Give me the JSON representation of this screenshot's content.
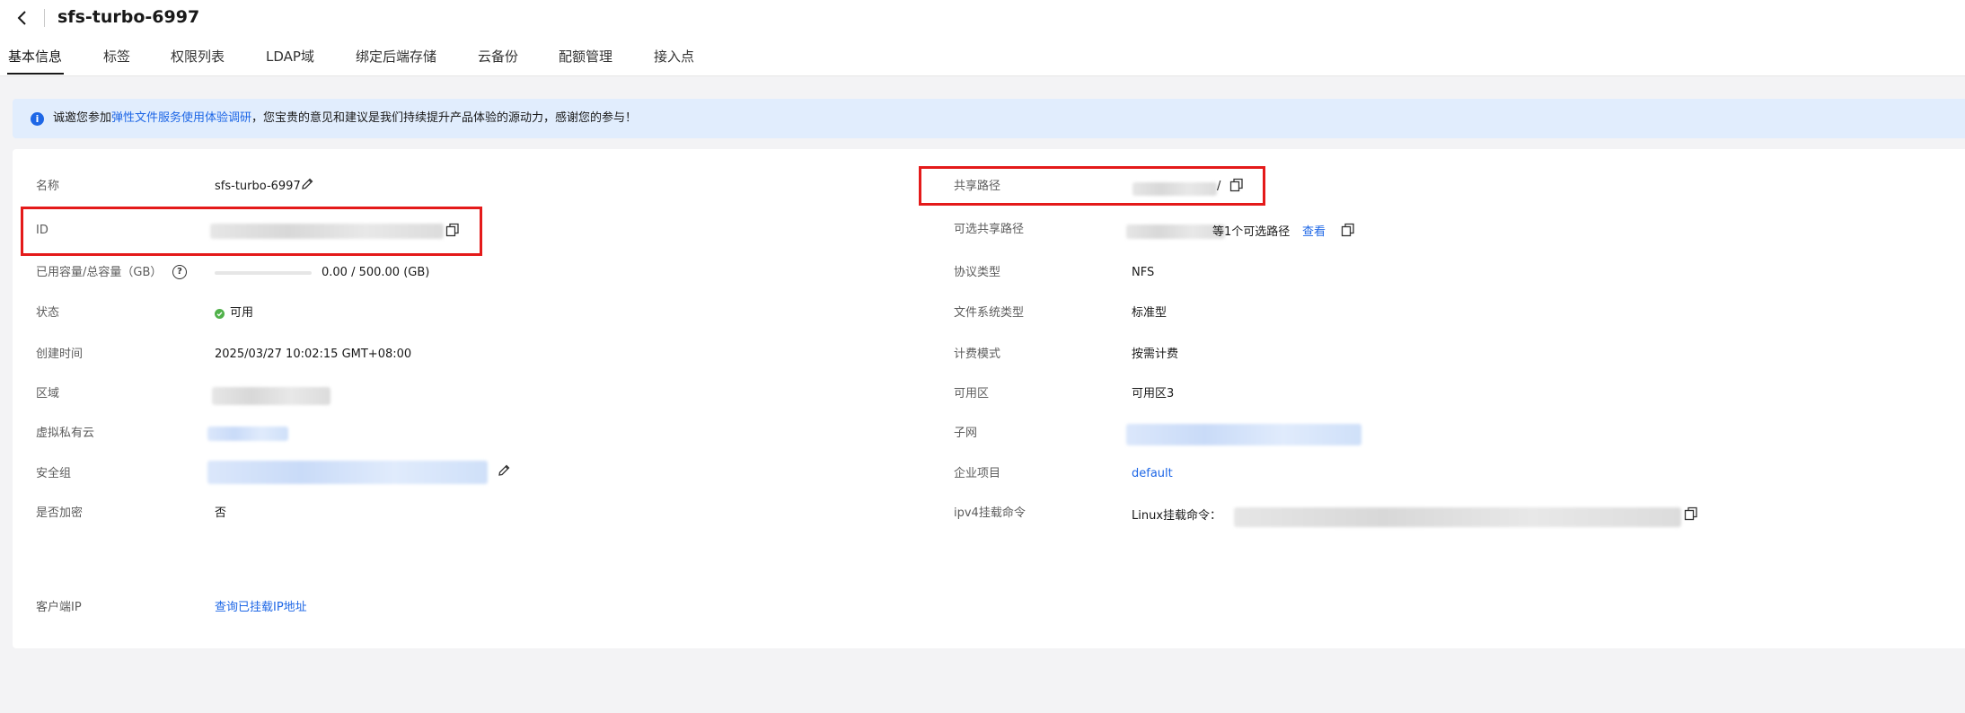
{
  "header": {
    "title": "sfs-turbo-6997"
  },
  "tabs": [
    {
      "label": "基本信息",
      "active": true
    },
    {
      "label": "标签"
    },
    {
      "label": "权限列表"
    },
    {
      "label": "LDAP域"
    },
    {
      "label": "绑定后端存储"
    },
    {
      "label": "云备份"
    },
    {
      "label": "配额管理"
    },
    {
      "label": "接入点"
    }
  ],
  "banner": {
    "prefix": "诚邀您参加",
    "link": "弹性文件服务使用体验调研",
    "suffix": "，您宝贵的意见和建议是我们持续提升产品体验的源动力，感谢您的参与！"
  },
  "left": {
    "name": {
      "label": "名称",
      "value": "sfs-turbo-6997"
    },
    "id": {
      "label": "ID"
    },
    "capacity": {
      "label": "已用容量/总容量（GB）",
      "value": "0.00 / 500.00 (GB)",
      "used_fraction": 0.0
    },
    "status": {
      "label": "状态",
      "value": "可用",
      "color": "#50b14a"
    },
    "created": {
      "label": "创建时间",
      "value": "2025/03/27 10:02:15 GMT+08:00"
    },
    "region": {
      "label": "区域"
    },
    "vpc": {
      "label": "虚拟私有云"
    },
    "security_group": {
      "label": "安全组"
    },
    "encrypted": {
      "label": "是否加密",
      "value": "否"
    },
    "client_ip": {
      "label": "客户端IP",
      "link": "查询已挂载IP地址"
    }
  },
  "right": {
    "share_path": {
      "label": "共享路径",
      "value_tail": "/"
    },
    "alt_paths": {
      "label": "可选共享路径",
      "suffix": "等1个可选路径",
      "view": "查看"
    },
    "protocol": {
      "label": "协议类型",
      "value": "NFS"
    },
    "fs_type": {
      "label": "文件系统类型",
      "value": "标准型"
    },
    "billing": {
      "label": "计费模式",
      "value": "按需计费"
    },
    "az": {
      "label": "可用区",
      "value": "可用区3"
    },
    "subnet": {
      "label": "子网"
    },
    "project": {
      "label": "企业项目",
      "value": "default"
    },
    "mount": {
      "label": "ipv4挂载命令",
      "prefix": "Linux挂载命令："
    }
  },
  "colors": {
    "accent": "#1e67e6",
    "highlight_box": "#e41a1a",
    "banner_bg": "#e1edfd"
  },
  "icons": [
    "back-arrow-icon",
    "info-icon",
    "edit-icon",
    "copy-icon",
    "help-icon",
    "status-dot-icon"
  ]
}
